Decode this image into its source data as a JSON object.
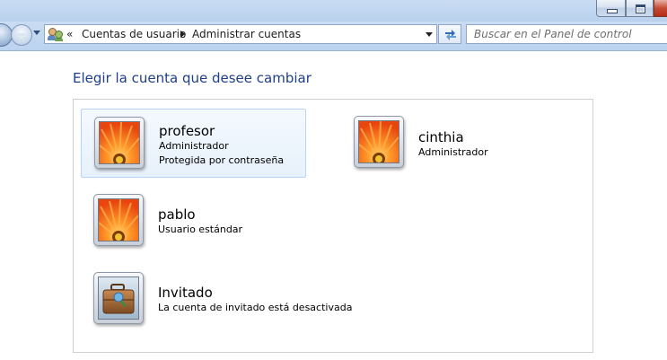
{
  "window": {
    "caption_buttons": [
      "minimize",
      "maximize",
      "close"
    ]
  },
  "navigation": {
    "back_icon": "back-arrow-icon",
    "forward_icon": "forward-arrow-icon",
    "breadcrumb_overflow": "«",
    "breadcrumbs": [
      {
        "label": "Cuentas de usuario"
      },
      {
        "label": "Administrar cuentas"
      }
    ],
    "refresh_icon": "refresh-icon",
    "search": {
      "placeholder": "Buscar en el Panel de control",
      "value": ""
    }
  },
  "main": {
    "title": "Elegir la cuenta que desee cambiar",
    "accounts": [
      {
        "name": "profesor",
        "lines": [
          "Administrador",
          "Protegida por contraseña"
        ],
        "avatar": "orange-flower-avatar",
        "selected": true
      },
      {
        "name": "cinthia",
        "lines": [
          "Administrador"
        ],
        "avatar": "orange-flower-avatar",
        "selected": false
      },
      {
        "name": "pablo",
        "lines": [
          "Usuario estándar"
        ],
        "avatar": "orange-flower-avatar",
        "selected": false
      },
      {
        "name": "Invitado",
        "lines": [
          "La cuenta de invitado está desactivada"
        ],
        "avatar": "guest-suitcase-avatar",
        "selected": false
      }
    ]
  },
  "colors": {
    "title_blue": "#1e3f87",
    "selection_border": "#b8d6f4",
    "chrome_blue": "#c9dcf2"
  }
}
